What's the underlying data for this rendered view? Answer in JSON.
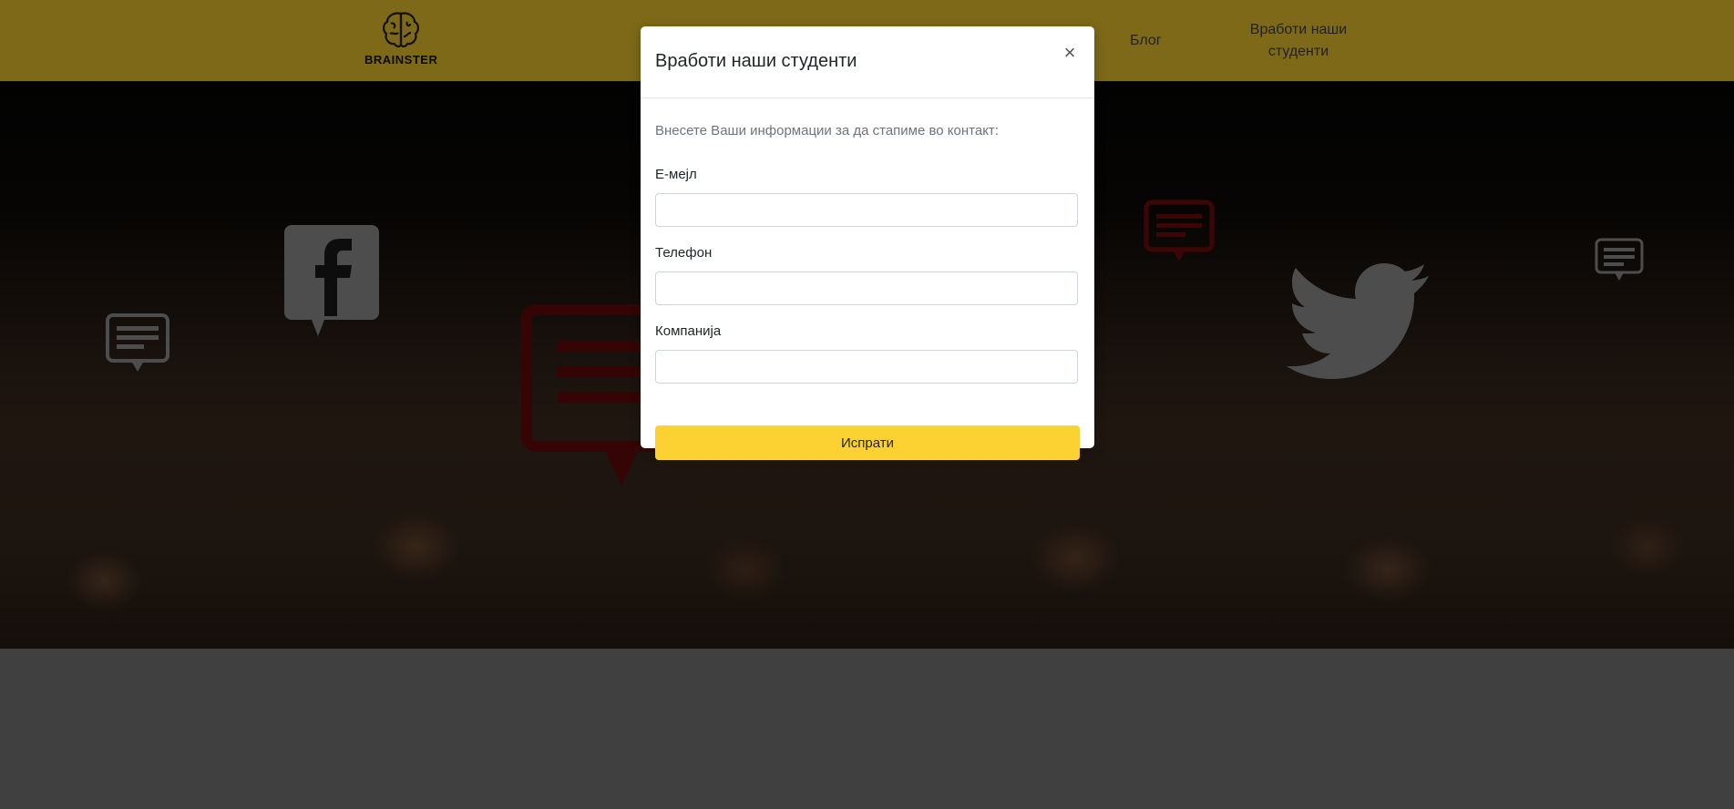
{
  "navbar": {
    "brand": "BRAINSTER",
    "links": {
      "hidden": "",
      "blog": "Блог",
      "hire": "Вработи наши студенти"
    }
  },
  "hero": {
    "icons": [
      "facebook-icon",
      "twitter-icon",
      "chat-bubble-icon"
    ]
  },
  "modal": {
    "title": "Вработи наши студенти",
    "close_label": "×",
    "intro": "Внесете Ваши информации за да стапиме во контакт:",
    "fields": {
      "email": {
        "label": "Е-мејл",
        "value": ""
      },
      "phone": {
        "label": "Телефон",
        "value": ""
      },
      "company": {
        "label": "Компанија",
        "value": ""
      }
    },
    "submit_label": "Испрати"
  },
  "colors": {
    "brand_yellow": "#fbd231",
    "accent_red": "#8b0000"
  }
}
